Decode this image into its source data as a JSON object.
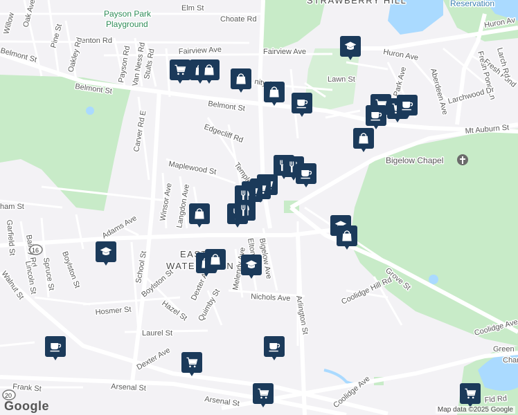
{
  "map": {
    "attribution": "Map data ©2025 Google",
    "logo": "Google",
    "colors": {
      "background": "#f3f2f5",
      "park": "#c8ebc8",
      "water": "#aadaff",
      "road": "#ffffff",
      "marker": "#1b3a5a"
    },
    "area_labels": {
      "strawberry_hill": "STRAWBERRY HILL",
      "east_watertown_1": "EAST",
      "east_watertown_2": "WATERTOWN"
    },
    "poi_labels": {
      "payson_park_1": "Payson Park",
      "payson_park_2": "Playground",
      "bigelow_chapel": "Bigelow Chapel",
      "reservation": "Reservation"
    },
    "street_labels": {
      "elm_st": "Elm St",
      "choate_rd": "Choate Rd",
      "oak_ave": "Oak Ave",
      "willow": "Willow",
      "pine_st": "Pine St",
      "benton_rd": "Benton Rd",
      "oakley_rd": "Oakley Rd",
      "payson_rd": "Payson Rd",
      "van_ness_rd": "Van Ness Rd",
      "stults_rd": "Stults Rd",
      "belmont_st_w": "Belmont St",
      "belmont_st_c": "Belmont St",
      "belmont_st_e": "Belmont St",
      "fairview_ave_w": "Fairview Ave",
      "fairview_ave_e": "Fairview Ave",
      "huron_ave": "Huron Ave",
      "huron_av": "Huron Av",
      "lawn_st": "Lawn St",
      "park_ave": "Park Ave",
      "aberdeen_ave": "Aberdeen Ave",
      "fresh_pond_ln": "Fresh Pond Ln",
      "fresh_pond": "Fresh Pond",
      "larch_rd": "Larch Rd",
      "larchwood_dr": "Larchwood Dr",
      "mt_auburn_st": "Mt Auburn St",
      "carver_rd_e": "Carver Rd E",
      "edgecliff_rd": "Edgecliff Rd",
      "maplewood_st": "Maplewood St",
      "templeton": "Templeton",
      "winsor_ave": "Winsor Ave",
      "langdon_ave": "Langdon Ave",
      "ham_st": "ham St",
      "adams_ave": "Adams Ave",
      "bailey_rd": "Bailey Rd",
      "garfield_st": "Garfield St",
      "lincoln_st": "Lincoln St",
      "spruce_st": "Spruce St",
      "boylston_st_1": "Boylston St",
      "boylston_st_2": "Boylston St",
      "school_st": "School St",
      "walnut_st": "Walnut St",
      "hosmer_st": "Hosmer St",
      "hazel_st": "Hazel St",
      "dexter_ave_1": "Dexter Ave",
      "dexter_ave_2": "Dexter Ave",
      "quimby_st": "Quimby St",
      "melendy_ave": "Melendy Ave",
      "elton": "Elton",
      "bigelow_ave": "Bigelow Ave",
      "nichols_ave": "Nichols Ave",
      "arlington_st": "Arlington St",
      "coolidge_hill_rd": "Coolidge Hill Rd",
      "grove_st": "Grove St",
      "coolidge_ave_e": "Coolidge Ave",
      "coolidge_ave_s": "Coolidge Ave",
      "laurel_st": "Laurel St",
      "frank_st": "Frank St",
      "arsenal_st_1": "Arsenal St",
      "arsenal_st_2": "Arsenal St",
      "fld_rd": "Fld Rd",
      "unity_ave": "nity Ave",
      "route_16": "16",
      "route_20": "20",
      "green": "Green",
      "char": "Char"
    },
    "markers": [
      {
        "name": "grocery",
        "icon": "cart-icon"
      },
      {
        "name": "shop",
        "icon": "bag-icon"
      },
      {
        "name": "shop",
        "icon": "bag-icon"
      },
      {
        "name": "shop",
        "icon": "bag-icon"
      },
      {
        "name": "shop",
        "icon": "bag-icon"
      },
      {
        "name": "cafe",
        "icon": "cup-icon"
      },
      {
        "name": "school",
        "icon": "school-icon"
      },
      {
        "name": "grocery",
        "icon": "cart-icon"
      },
      {
        "name": "grocery",
        "icon": "cart-icon"
      },
      {
        "name": "cafe",
        "icon": "cup-icon"
      },
      {
        "name": "cafe",
        "icon": "cup-icon"
      },
      {
        "name": "shop",
        "icon": "bag-icon"
      },
      {
        "name": "restaurant",
        "icon": "fork-knife-icon"
      },
      {
        "name": "restaurant",
        "icon": "fork-knife-icon"
      },
      {
        "name": "cafe",
        "icon": "cup-icon"
      },
      {
        "name": "grocery",
        "icon": "cart-icon"
      },
      {
        "name": "grocery",
        "icon": "cart-icon"
      },
      {
        "name": "grocery",
        "icon": "cart-icon"
      },
      {
        "name": "restaurant",
        "icon": "fork-knife-icon"
      },
      {
        "name": "shop",
        "icon": "bag-icon"
      },
      {
        "name": "restaurant",
        "icon": "fork-knife-icon"
      },
      {
        "name": "restaurant",
        "icon": "fork-knife-icon"
      },
      {
        "name": "school",
        "icon": "school-icon"
      },
      {
        "name": "shop",
        "icon": "bag-icon"
      },
      {
        "name": "school",
        "icon": "school-icon"
      },
      {
        "name": "shop",
        "icon": "bag-icon"
      },
      {
        "name": "shop",
        "icon": "bag-icon"
      },
      {
        "name": "school",
        "icon": "school-icon"
      },
      {
        "name": "cafe",
        "icon": "cup-icon"
      },
      {
        "name": "cafe",
        "icon": "cup-icon"
      },
      {
        "name": "grocery",
        "icon": "cart-icon"
      },
      {
        "name": "grocery",
        "icon": "cart-icon"
      },
      {
        "name": "grocery",
        "icon": "cart-icon"
      }
    ]
  }
}
